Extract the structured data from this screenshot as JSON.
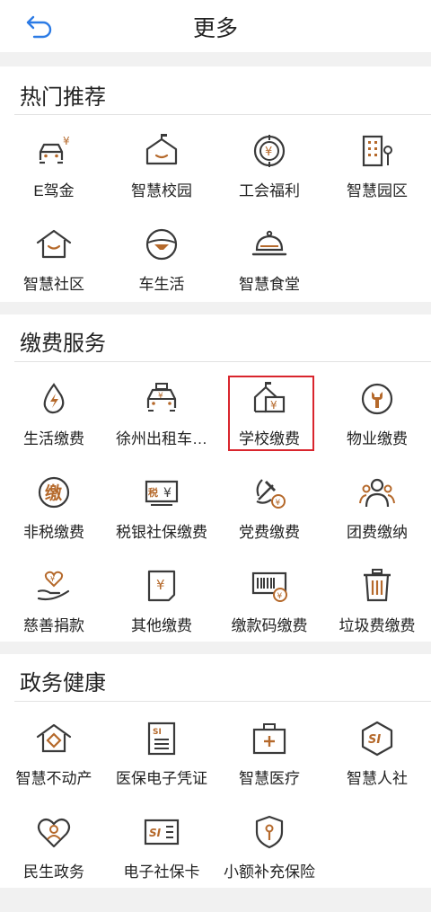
{
  "header": {
    "title": "更多",
    "back_icon": "back-arrow-icon"
  },
  "colors": {
    "accent": "#b5692b",
    "line": "#3a3a3a",
    "blue": "#2c7be5",
    "highlight": "#d9252d"
  },
  "sections": [
    {
      "title": "热门推荐",
      "items": [
        {
          "label": "E驾金",
          "icon": "car-yuan-icon"
        },
        {
          "label": "智慧校园",
          "icon": "school-house-icon"
        },
        {
          "label": "工会福利",
          "icon": "union-badge-icon"
        },
        {
          "label": "智慧园区",
          "icon": "office-building-icon"
        },
        {
          "label": "智慧社区",
          "icon": "home-smile-icon"
        },
        {
          "label": "车生活",
          "icon": "steering-wheel-icon"
        },
        {
          "label": "智慧食堂",
          "icon": "food-dome-icon"
        }
      ]
    },
    {
      "title": "缴费服务",
      "items": [
        {
          "label": "生活缴费",
          "icon": "water-drop-bolt-icon"
        },
        {
          "label": "徐州出租车…",
          "icon": "taxi-icon"
        },
        {
          "label": "学校缴费",
          "icon": "school-yuan-icon"
        },
        {
          "label": "物业缴费",
          "icon": "wrench-icon"
        },
        {
          "label": "非税缴费",
          "icon": "tax-coin-icon"
        },
        {
          "label": "税银社保缴费",
          "icon": "tax-bank-card-icon"
        },
        {
          "label": "党费缴费",
          "icon": "party-emblem-icon"
        },
        {
          "label": "团费缴纳",
          "icon": "people-group-icon"
        },
        {
          "label": "慈善捐款",
          "icon": "charity-hand-icon"
        },
        {
          "label": "其他缴费",
          "icon": "bill-yuan-icon"
        },
        {
          "label": "缴款码缴费",
          "icon": "barcode-icon"
        },
        {
          "label": "垃圾费缴费",
          "icon": "trash-bin-icon"
        }
      ]
    },
    {
      "title": "政务健康",
      "items": [
        {
          "label": "智慧不动产",
          "icon": "house-diamond-icon"
        },
        {
          "label": "医保电子凭证",
          "icon": "medical-insurance-doc-icon"
        },
        {
          "label": "智慧医疗",
          "icon": "medical-kit-icon"
        },
        {
          "label": "智慧人社",
          "icon": "si-shield-icon"
        },
        {
          "label": "民生政务",
          "icon": "heart-person-icon"
        },
        {
          "label": "电子社保卡",
          "icon": "si-card-icon"
        },
        {
          "label": "小额补充保险",
          "icon": "shield-key-icon"
        }
      ]
    }
  ]
}
